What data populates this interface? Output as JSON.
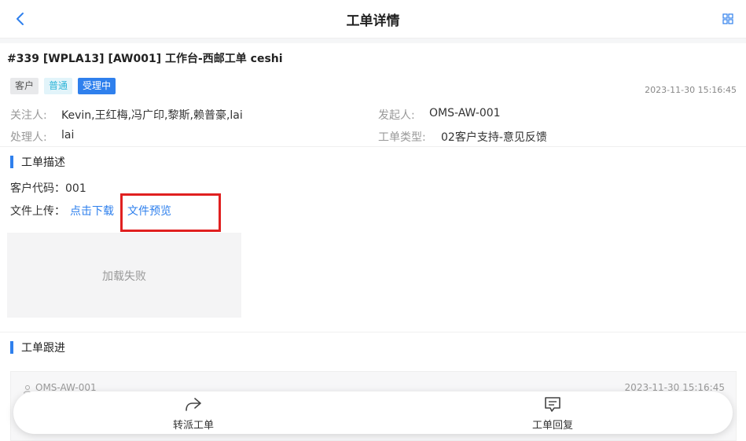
{
  "header": {
    "title": "工单详情",
    "back_icon": "chevron-left-icon",
    "menu_icon": "grid-icon"
  },
  "order": {
    "title": "#339 [WPLA13] [AW001] 工作台-西邮工单 ceshi",
    "tags": [
      {
        "label": "客户",
        "color": "#e8e9eb"
      },
      {
        "label": "普通",
        "color": "#e2f4fa"
      },
      {
        "label": "受理中",
        "color": "#2f80ed"
      }
    ],
    "created_at": "2023-11-30 15:16:45"
  },
  "info": {
    "followers_label": "关注人:",
    "followers_value": "Kevin,王红梅,冯广印,黎斯,赖普豪,lai",
    "initiator_label": "发起人:",
    "initiator_value": "OMS-AW-001",
    "handler_label": "处理人:",
    "handler_value": "lai",
    "type_label": "工单类型:",
    "type_value": "02客户支持-意见反馈"
  },
  "description": {
    "section_title": "工单描述",
    "customer_code": "客户代码：001",
    "file_upload_label": "文件上传：",
    "download_link": "点击下载",
    "preview_link": "文件预览",
    "image_failed": "加载失败"
  },
  "followup": {
    "section_title": "工单跟进",
    "reply": {
      "user": "OMS-AW-001",
      "time": "2023-11-30 15:16:45"
    }
  },
  "actions": {
    "forward_label": "转派工单",
    "reply_label": "工单回复"
  },
  "colors": {
    "accent": "#2f80ed",
    "highlight_border": "#e02020"
  }
}
